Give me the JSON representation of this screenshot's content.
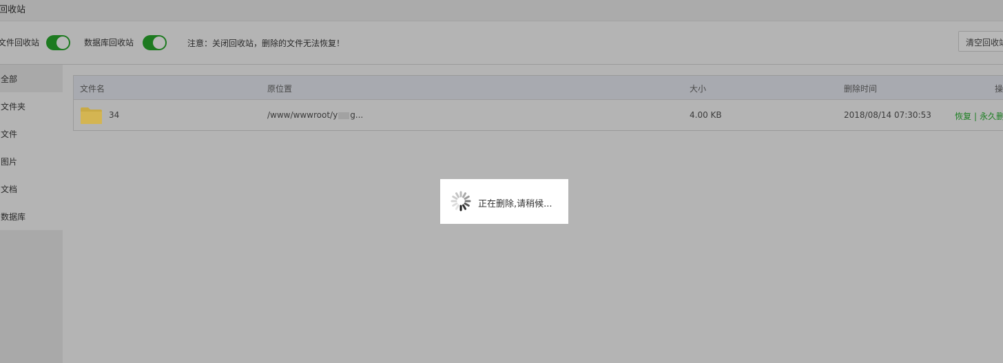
{
  "header": {
    "title": "回收站"
  },
  "toolbar": {
    "file_recycle_label": "文件回收站",
    "db_recycle_label": "数据库回收站",
    "notice": "注意：关闭回收站，删除的文件无法恢复！",
    "clear_button": "清空回收站",
    "accent_color": "#1d7a20"
  },
  "sidebar": {
    "items": [
      {
        "label": "全部",
        "active": false
      },
      {
        "label": "文件夹",
        "active": true
      },
      {
        "label": "文件",
        "active": false
      },
      {
        "label": "图片",
        "active": false
      },
      {
        "label": "文档",
        "active": false
      },
      {
        "label": "数据库",
        "active": false
      }
    ]
  },
  "table": {
    "columns": [
      "文件名",
      "原位置",
      "大小",
      "删除时间",
      "操作"
    ],
    "rows": [
      {
        "icon": "folder-icon",
        "name": "34",
        "path_prefix": "/www/wwwroot/y",
        "path_suffix": "g...",
        "size": "4.00 KB",
        "deleted_at": "2018/08/14 07:30:53",
        "restore": "恢复",
        "separator": "|",
        "delete": "永久删除"
      }
    ]
  },
  "loading": {
    "message": "正在删除,请稍候..."
  }
}
